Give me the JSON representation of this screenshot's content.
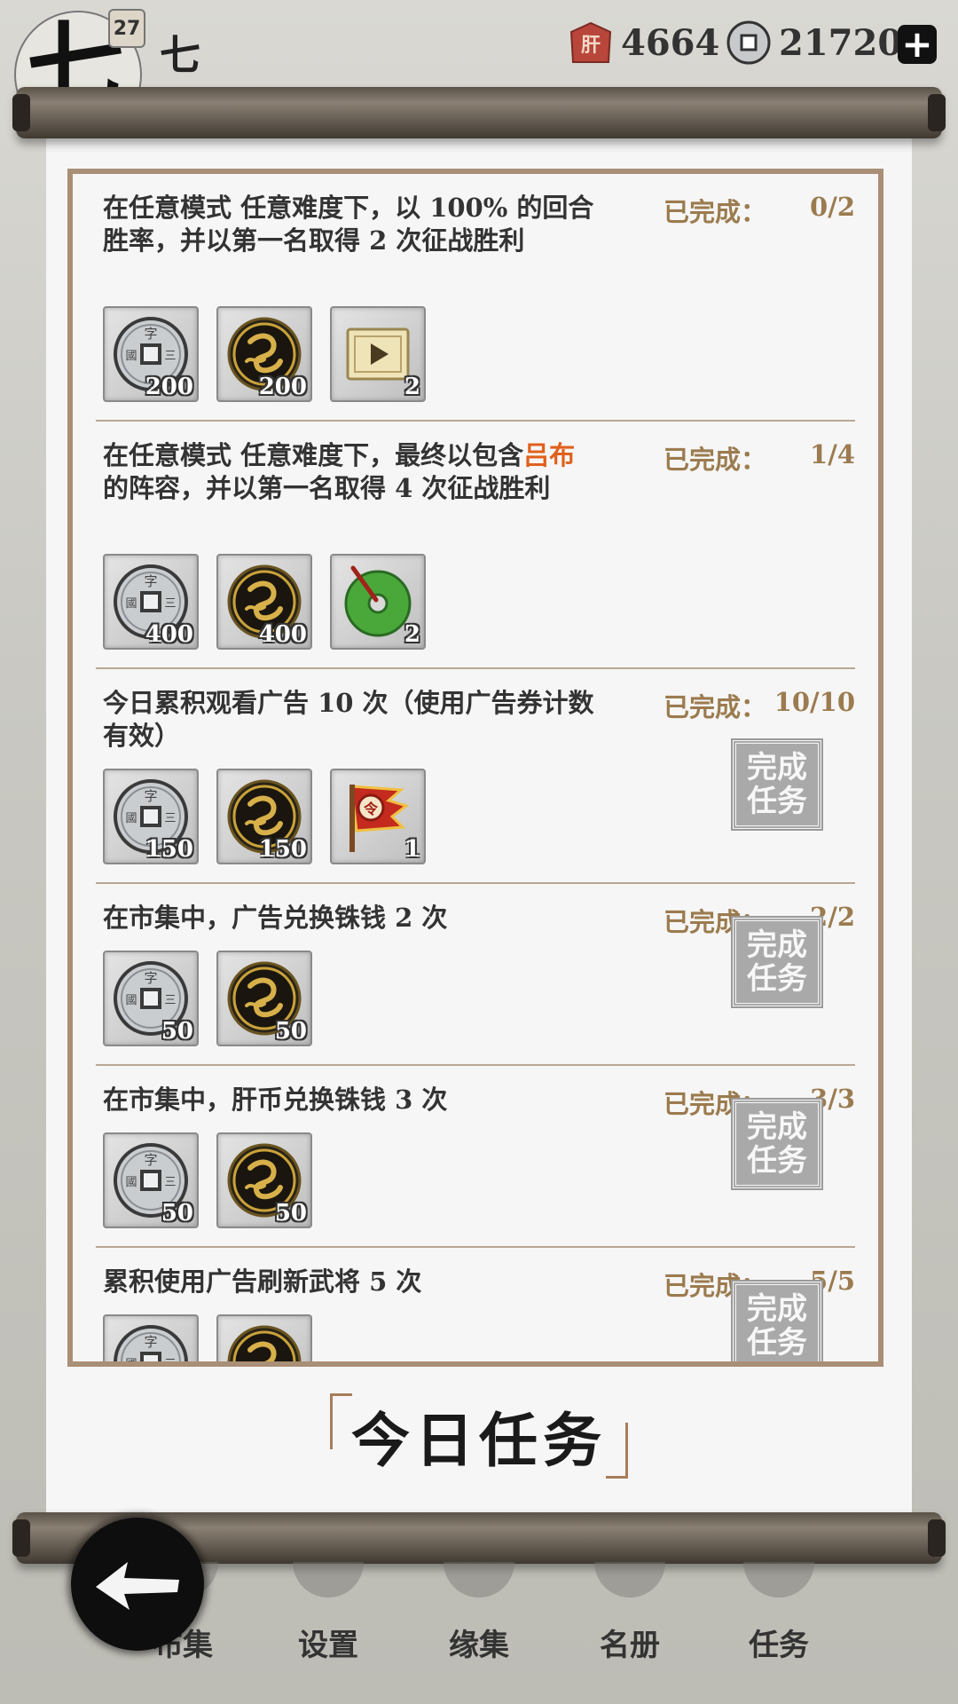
{
  "header": {
    "avatar_char": "七",
    "level": "27",
    "player_name": "七",
    "liver_coins": "4664",
    "copper_coins": "21720",
    "plus": "+"
  },
  "tasks": [
    {
      "desc": "在任意模式 任意难度下，以 100% 的回合胜率，并以第一名取得 2 次征战胜利",
      "status_label": "已完成：",
      "progress": "0/2",
      "rewards": [
        {
          "icon": "copper-coin-icon",
          "qty": "200"
        },
        {
          "icon": "gold-medallion-icon",
          "qty": "200"
        },
        {
          "icon": "ad-ticket-icon",
          "qty": "2"
        }
      ]
    },
    {
      "desc_pre": "在任意模式 任意难度下，最终以包含",
      "desc_hl": "吕布",
      "desc_post": " 的阵容，并以第一名取得 4 次征战胜利",
      "status_label": "已完成：",
      "progress": "1/4",
      "rewards": [
        {
          "icon": "copper-coin-icon",
          "qty": "400"
        },
        {
          "icon": "gold-medallion-icon",
          "qty": "400"
        },
        {
          "icon": "jade-disc-icon",
          "qty": "2"
        }
      ]
    },
    {
      "desc": "今日累积观看广告 10 次（使用广告券计数有效）",
      "status_label": "已完成：",
      "progress": "10/10",
      "complete_label": "完成任务",
      "rewards": [
        {
          "icon": "copper-coin-icon",
          "qty": "150"
        },
        {
          "icon": "gold-medallion-icon",
          "qty": "150"
        },
        {
          "icon": "command-flag-icon",
          "qty": "1"
        }
      ]
    },
    {
      "desc": "在市集中，广告兑换铢钱 2 次",
      "status_label": "已完成：",
      "progress": "2/2",
      "complete_label": "完成任务",
      "rewards": [
        {
          "icon": "copper-coin-icon",
          "qty": "50"
        },
        {
          "icon": "gold-medallion-icon",
          "qty": "50"
        }
      ]
    },
    {
      "desc": "在市集中，肝币兑换铢钱 3 次",
      "status_label": "已完成：",
      "progress": "3/3",
      "complete_label": "完成任务",
      "rewards": [
        {
          "icon": "copper-coin-icon",
          "qty": "50"
        },
        {
          "icon": "gold-medallion-icon",
          "qty": "50"
        }
      ]
    },
    {
      "desc": "累积使用广告刷新武将 5 次",
      "status_label": "已完成：",
      "progress": "5/5",
      "complete_label": "完成任务",
      "rewards": [
        {
          "icon": "copper-coin-icon",
          "qty": ""
        },
        {
          "icon": "gold-medallion-icon",
          "qty": ""
        }
      ]
    }
  ],
  "title": "今日任务",
  "nav": [
    "布集",
    "设置",
    "缘集",
    "名册",
    "任务"
  ],
  "colors": {
    "highlight": "#e0611c",
    "status": "#9b7b4f",
    "frame": "#a98f76"
  }
}
